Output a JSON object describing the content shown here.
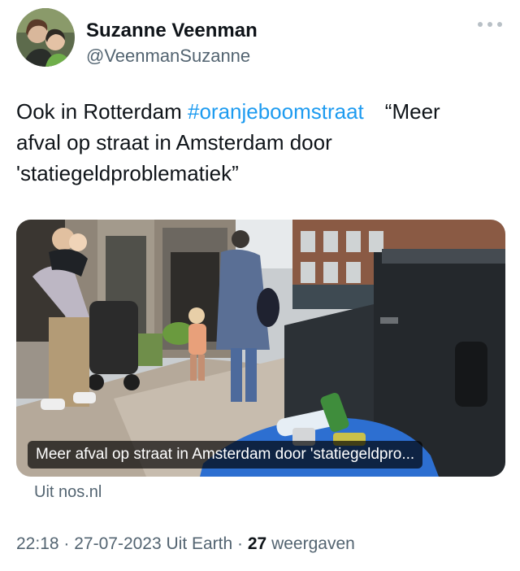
{
  "user": {
    "name": "Suzanne Veenman",
    "handle": "@VeenmanSuzanne"
  },
  "tweet": {
    "line1_prefix": "Ook in Rotterdam ",
    "hashtag": "#oranjeboomstraat",
    "line1_suffix": "“Meer",
    "line2": "afval op straat in Amsterdam door",
    "line3": "'statiegeldproblematiek”"
  },
  "media": {
    "caption": "Meer afval op straat in Amsterdam door 'statiegeldpro..."
  },
  "link_source": "Uit nos.nl",
  "meta": {
    "time": "22:18",
    "date": "27-07-2023",
    "client": "Uit Earth",
    "views_count": "27",
    "views_label": "weergaven"
  },
  "colors": {
    "text": "#0f1419",
    "secondary": "#536471",
    "hashtag": "#1d9bf0"
  },
  "icons": {
    "more": "more-horizontal-icon"
  }
}
